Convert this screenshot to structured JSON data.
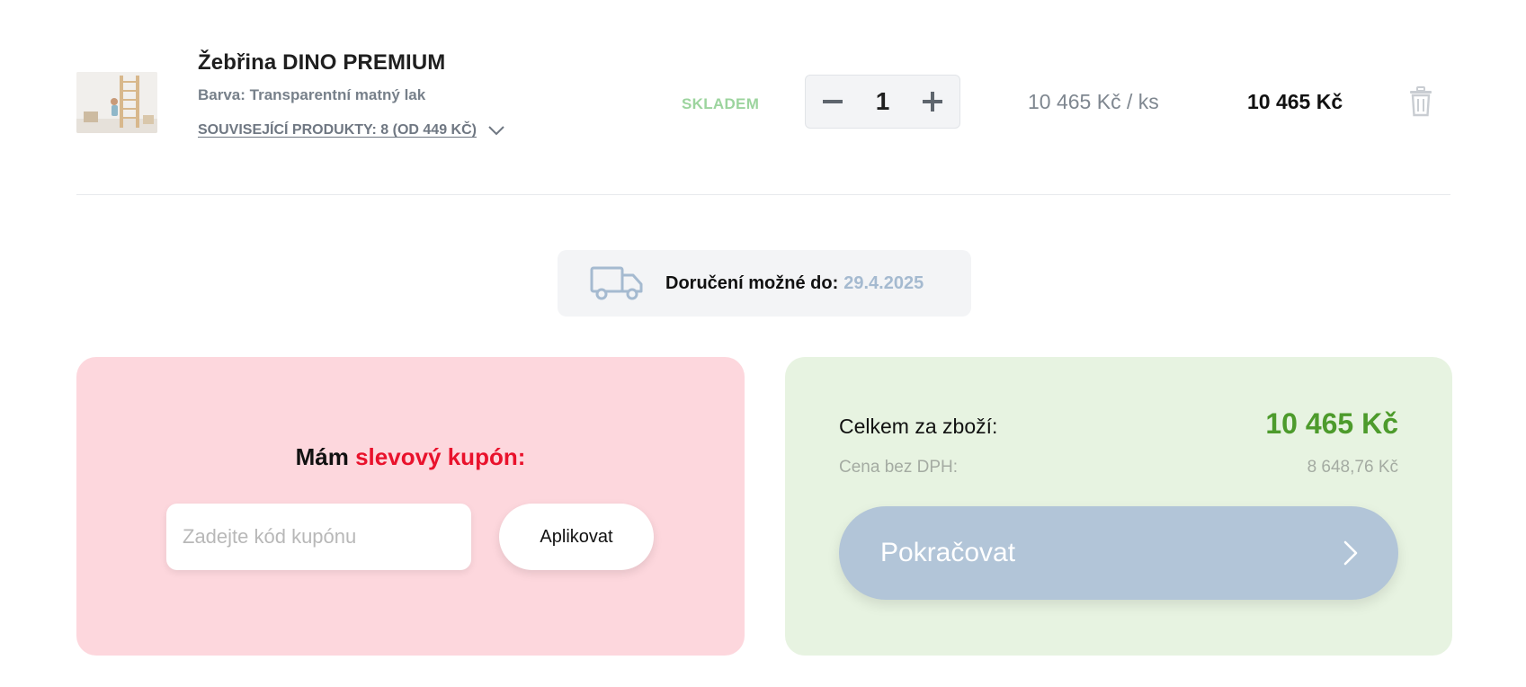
{
  "product": {
    "title": "Žebřina DINO PREMIUM",
    "variant": "Barva: Transparentní matný lak",
    "related_label": "SOUVISEJÍCÍ PRODUKTY: 8 (OD 449 KČ)",
    "stock": "SKLADEM",
    "quantity": "1",
    "unit_price": "10 465 Kč  / ks",
    "total_price": "10 465 Kč",
    "icons": {
      "minus": "minus-icon",
      "plus": "plus-icon",
      "chevron": "chevron-down-icon",
      "trash": "trash-icon"
    }
  },
  "delivery": {
    "label": "Doručení možné do:",
    "date": "29.4.2025",
    "icon": "truck-icon"
  },
  "coupon": {
    "title_prefix": "Mám",
    "title_accent": "slevový kupón:",
    "input_placeholder": "Zadejte kód kupónu",
    "input_value": "",
    "apply_label": "Aplikovat"
  },
  "summary": {
    "total_label": "Celkem za zboží:",
    "total_value": "10 465 Kč",
    "net_label": "Cena bez DPH:",
    "net_value": "8 648,76 Kč",
    "continue_label": "Pokračovat",
    "continue_icon": "chevron-right-icon"
  },
  "colors": {
    "stock_green": "#9cd49e",
    "total_green": "#4d9b2c",
    "coupon_bg": "#fdd7dd",
    "coupon_accent": "#e9122c",
    "summary_bg": "#e7f3e1",
    "continue_bg": "#b2c5d8",
    "delivery_date": "#a5bad0"
  }
}
